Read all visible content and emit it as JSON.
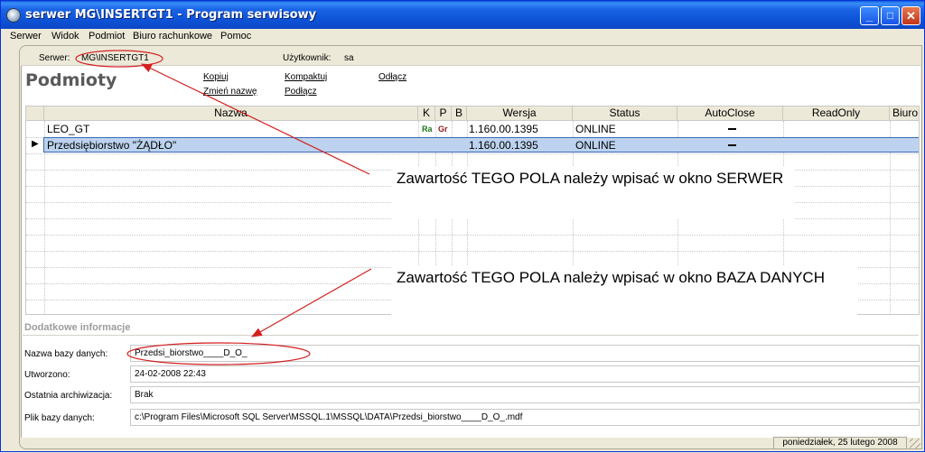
{
  "window": {
    "title": "serwer MG\\INSERTGT1 - Program serwisowy",
    "minimize": "_",
    "maximize": "□",
    "close": "✕"
  },
  "menu": [
    {
      "label": "Serwer"
    },
    {
      "label": "Widok"
    },
    {
      "label": "Podmiot"
    },
    {
      "label": "Biuro rachunkowe"
    },
    {
      "label": "Pomoc"
    }
  ],
  "topbar": {
    "server_label": "Serwer:",
    "server_value": "MG\\INSERTGT1",
    "user_label": "Użytkownik:",
    "user_value": "sa"
  },
  "heading": "Podmioty",
  "actions": {
    "copy": "Kopiuj",
    "rename": "Zmień nazwę",
    "compact": "Kompaktuj",
    "attach": "Podłącz",
    "detach": "Odłącz"
  },
  "grid": {
    "columns": [
      "Nazwa",
      "K",
      "P",
      "B",
      "Wersja",
      "Status",
      "AutoClose",
      "ReadOnly",
      "Biuro"
    ],
    "rows": [
      {
        "name": "LEO_GT",
        "k": "Ra",
        "p": "Gr",
        "b": "",
        "version": "1.160.00.1395",
        "status": "ONLINE",
        "autoclose": "—",
        "readonly": "",
        "biuro": ""
      },
      {
        "name": "Przedsiębiorstwo \"ŻĄDŁO\"",
        "k": "",
        "p": "",
        "b": "",
        "version": "1.160.00.1395",
        "status": "ONLINE",
        "autoclose": "—",
        "readonly": "",
        "biuro": ""
      }
    ],
    "selected_marker": "▶"
  },
  "callouts": {
    "server": "Zawartość TEGO POLA należy wpisać w okno SERWER",
    "database": "Zawartość TEGO POLA należy wpisać w okno BAZA DANYCH"
  },
  "details": {
    "section_title": "Dodatkowe informacje",
    "db_name_label": "Nazwa bazy danych:",
    "db_name_value": "Przedsi_biorstwo____D_O_",
    "created_label": "Utworzono:",
    "created_value": "24-02-2008 22:43",
    "archive_label": "Ostatnia archiwizacja:",
    "archive_value": "Brak",
    "file_label": "Plik bazy danych:",
    "file_value": "c:\\Program Files\\Microsoft SQL Server\\MSSQL.1\\MSSQL\\DATA\\Przedsi_biorstwo____D_O_.mdf"
  },
  "statusbar": {
    "date": "poniedziałek, 25 lutego 2008"
  },
  "colors": {
    "k_badge": "#1a7a1a",
    "p_badge": "#8a1a1a",
    "annotation": "#d42020"
  }
}
